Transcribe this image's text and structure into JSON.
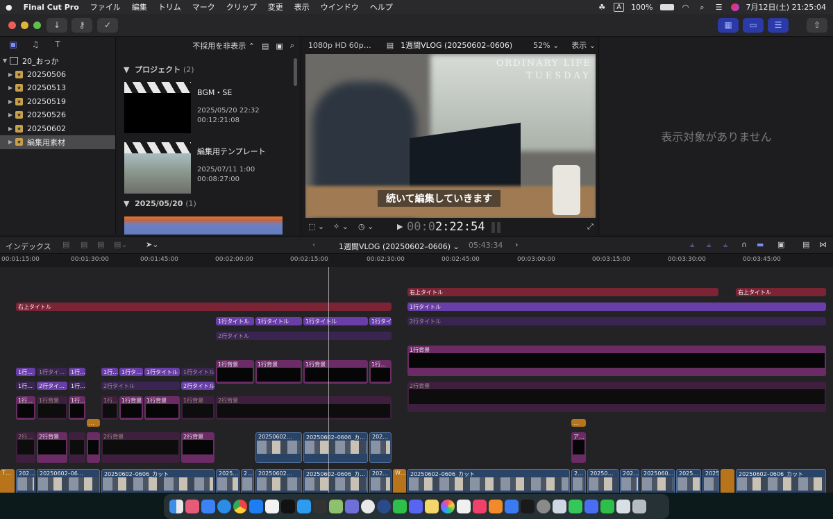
{
  "menubar": {
    "apple": "",
    "items": [
      "Final Cut Pro",
      "ファイル",
      "編集",
      "トリム",
      "マーク",
      "クリップ",
      "変更",
      "表示",
      "ウインドウ",
      "ヘルプ"
    ],
    "input_indicator": "A",
    "battery": "100%",
    "datetime": "7月12日(土)  21:25:04"
  },
  "library": {
    "root": "20_おっか",
    "events": [
      "20250506",
      "20250513",
      "20250519",
      "20250526",
      "20250602",
      "編集用素材"
    ],
    "selected_index": 5
  },
  "browser": {
    "filter": "不採用を非表示 ⌃",
    "section1": {
      "label": "プロジェクト",
      "count": "(2)"
    },
    "projects": [
      {
        "name": "BGM・SE",
        "date": "2025/05/20 22:32",
        "duration": "00:12:21:08"
      },
      {
        "name": "編集用テンプレート",
        "date": "2025/07/11 1:00",
        "duration": "00:08:27:00"
      }
    ],
    "section2": {
      "label": "2025/05/20",
      "count": "(1)"
    }
  },
  "viewer": {
    "format": "1080p HD 60p…",
    "project": "1週間VLOG (20250602–0606)",
    "zoom": "52% ⌄",
    "view": "表示 ⌄",
    "overlay_line1": "ORDINARY LIFE",
    "overlay_line2": "TUESDAY",
    "subtitle": "続いて編集していきます",
    "timecode_dim": "00:0",
    "timecode": "2:22:54"
  },
  "inspector": {
    "empty": "表示対象がありません"
  },
  "timeline": {
    "index_label": "インデックス",
    "project": "1週間VLOG (20250602–0606) ⌄",
    "duration": "05:43:34",
    "ruler": [
      "00:01:15:00",
      "00:01:30:00",
      "00:01:45:00",
      "00:02:00:00",
      "00:02:15:00",
      "00:02:30:00",
      "00:02:45:00",
      "00:03:00:00",
      "00:03:15:00",
      "00:03:30:00",
      "00:03:45:00"
    ],
    "labels": {
      "right_title": "右上タイトル",
      "title1": "1行タイトル",
      "title1s": "1行タイ…",
      "title1xs": "1行…",
      "title1ss": "1行タ…",
      "title2": "2行タイトル",
      "title2s": "2行タイ…",
      "bg1": "1行背景",
      "bg1xs": "1行…",
      "bg2": "2行背景",
      "bg2xs": "2行…",
      "clip_cut": "20250602–0606_カット",
      "clip_cut_s": "20250602–06…",
      "clip_short": "20250602…",
      "clip_cut_m": "20250602–0606_カ…",
      "clip_202": "202…",
      "clip_2025": "2025…",
      "clip_20250": "20250…",
      "clip_20250602": "2025060…",
      "clip_2": "2…",
      "clip_a": "ア…",
      "clip_t": "T…",
      "clip_w": "W…",
      "dots": "…"
    }
  },
  "colors": {
    "accent": "#7b8cff",
    "title_red": "#7a2436",
    "title_purple": "#6a3ea8",
    "background_clip": "#6b2c66",
    "video_clip": "#2a4468",
    "gap_clip": "#b8741a"
  }
}
